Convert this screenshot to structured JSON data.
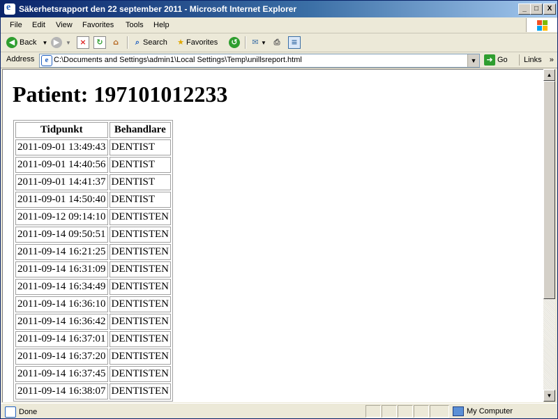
{
  "window": {
    "title": "Säkerhetsrapport den 22 september 2011 - Microsoft Internet Explorer",
    "buttons": {
      "minimize": "_",
      "maximize": "□",
      "close": "X"
    }
  },
  "menu": {
    "items": [
      "File",
      "Edit",
      "View",
      "Favorites",
      "Tools",
      "Help"
    ]
  },
  "toolbar": {
    "back_label": "Back",
    "search_label": "Search",
    "favorites_label": "Favorites"
  },
  "address": {
    "label": "Address",
    "value": "C:\\Documents and Settings\\admin1\\Local Settings\\Temp\\unillsreport.html",
    "go_label": "Go",
    "links_label": "Links"
  },
  "page": {
    "heading": "Patient: 197101012233",
    "table": {
      "headers": [
        "Tidpunkt",
        "Behandlare"
      ],
      "rows": [
        [
          "2011-09-01 13:49:43",
          "DENTIST"
        ],
        [
          "2011-09-01 14:40:56",
          "DENTIST"
        ],
        [
          "2011-09-01 14:41:37",
          "DENTIST"
        ],
        [
          "2011-09-01 14:50:40",
          "DENTIST"
        ],
        [
          "2011-09-12 09:14:10",
          "DENTISTEN"
        ],
        [
          "2011-09-14 09:50:51",
          "DENTISTEN"
        ],
        [
          "2011-09-14 16:21:25",
          "DENTISTEN"
        ],
        [
          "2011-09-14 16:31:09",
          "DENTISTEN"
        ],
        [
          "2011-09-14 16:34:49",
          "DENTISTEN"
        ],
        [
          "2011-09-14 16:36:10",
          "DENTISTEN"
        ],
        [
          "2011-09-14 16:36:42",
          "DENTISTEN"
        ],
        [
          "2011-09-14 16:37:01",
          "DENTISTEN"
        ],
        [
          "2011-09-14 16:37:20",
          "DENTISTEN"
        ],
        [
          "2011-09-14 16:37:45",
          "DENTISTEN"
        ],
        [
          "2011-09-14 16:38:07",
          "DENTISTEN"
        ]
      ]
    }
  },
  "status": {
    "text": "Done",
    "zone": "My Computer"
  }
}
